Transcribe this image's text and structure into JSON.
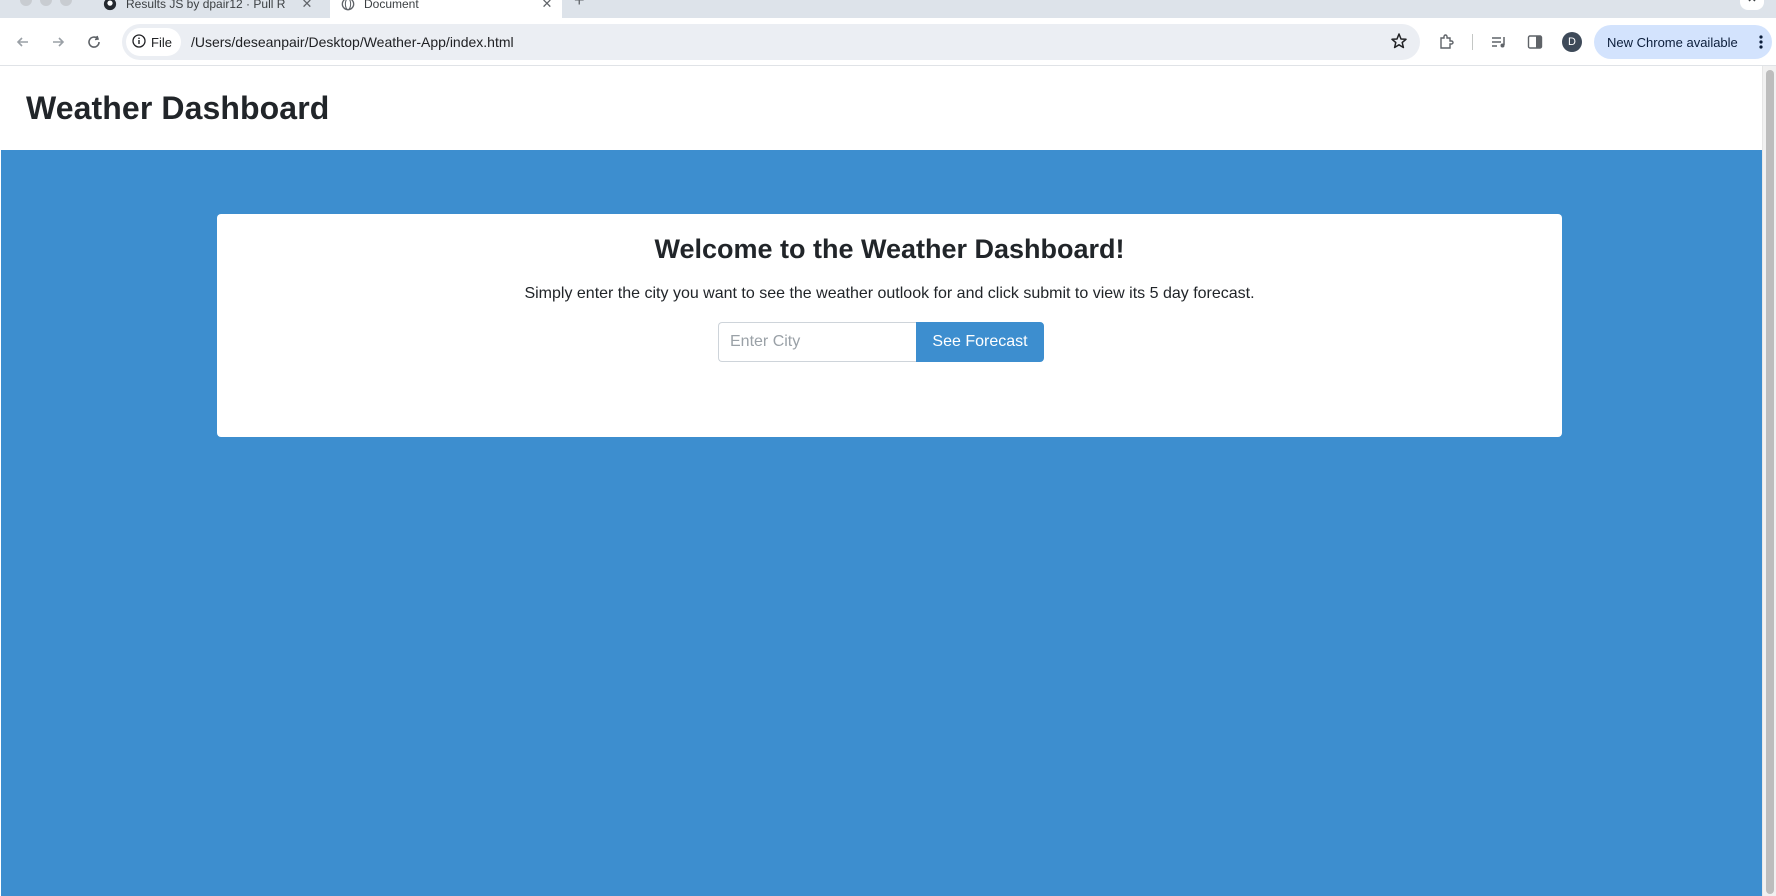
{
  "browser": {
    "tabs": [
      {
        "title": "Results JS by dpair12 · Pull R",
        "active": false,
        "icon": "github-icon"
      },
      {
        "title": "Document",
        "active": true,
        "icon": "globe-icon"
      }
    ],
    "new_tab_label": "+",
    "address": {
      "scheme_chip": "File",
      "url": "/Users/deseanpair/Desktop/Weather-App/index.html"
    },
    "profile_initial": "D",
    "update_button_label": "New Chrome available"
  },
  "page": {
    "header_title": "Weather Dashboard",
    "welcome_heading": "Welcome to the Weather Dashboard!",
    "instructions": "Simply enter the city you want to see the weather outlook for and click submit to view its 5 day forecast.",
    "search": {
      "placeholder": "Enter City",
      "value": "",
      "button_label": "See Forecast"
    }
  },
  "colors": {
    "accent": "#3d8ecf",
    "tab_strip": "#dde3ea",
    "update_pill": "#d3e3fd",
    "card": "#ffffff",
    "text": "#212529"
  }
}
